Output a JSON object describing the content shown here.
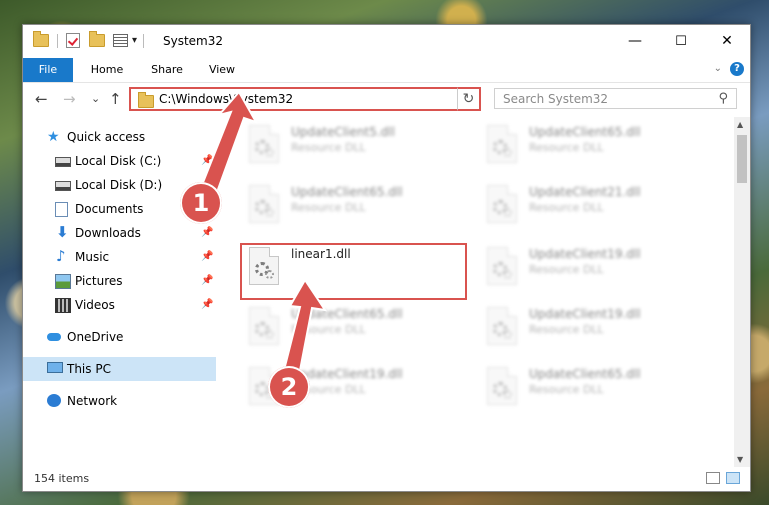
{
  "window": {
    "title": "System32",
    "min_glyph": "—",
    "max_glyph": "☐",
    "close_glyph": "✕"
  },
  "quick_access_toolbar": {
    "customize_glyph": "▾"
  },
  "ribbon": {
    "tabs": [
      "File",
      "Home",
      "Share",
      "View"
    ],
    "help_glyph": "?",
    "expand_glyph": "⌄"
  },
  "nav_buttons": {
    "back_glyph": "←",
    "forward_glyph": "→",
    "recent_glyph": "⌄",
    "up_glyph": "↑"
  },
  "address_bar": {
    "path": "C:\\Windows\\System32",
    "dropdown_glyph": "⌄",
    "refresh_glyph": "↻"
  },
  "search": {
    "placeholder": "Search System32",
    "icon_glyph": "⚲"
  },
  "nav_pane": {
    "items": [
      {
        "label": "Quick access",
        "icon": "star-icon",
        "pinned": false
      },
      {
        "label": "Local Disk (C:)",
        "icon": "drive-icon",
        "pinned": true
      },
      {
        "label": "Local Disk (D:)",
        "icon": "drive-icon",
        "pinned": false
      },
      {
        "label": "Documents",
        "icon": "documents-icon",
        "pinned": true
      },
      {
        "label": "Downloads",
        "icon": "downloads-icon",
        "pinned": true
      },
      {
        "label": "Music",
        "icon": "music-icon",
        "pinned": true
      },
      {
        "label": "Pictures",
        "icon": "pictures-icon",
        "pinned": true
      },
      {
        "label": "Videos",
        "icon": "videos-icon",
        "pinned": true
      },
      {
        "label": "OneDrive",
        "icon": "onedrive-icon",
        "pinned": false
      },
      {
        "label": "This PC",
        "icon": "this-pc-icon",
        "pinned": false,
        "selected": true
      },
      {
        "label": "Network",
        "icon": "network-icon",
        "pinned": false
      }
    ],
    "pin_glyph": "📌"
  },
  "files": [
    {
      "name": "UpdateClient5.dll",
      "type": "Resource DLL",
      "blurred": true
    },
    {
      "name": "UpdateClient65.dll",
      "type": "Resource DLL",
      "blurred": true
    },
    {
      "name": "UpdateClient65.dll",
      "type": "Resource DLL",
      "blurred": true
    },
    {
      "name": "UpdateClient21.dll",
      "type": "Resource DLL",
      "blurred": true
    },
    {
      "name": "linear1.dll",
      "type": "",
      "blurred": false,
      "highlighted": true
    },
    {
      "name": "UpdateClient19.dll",
      "type": "Resource DLL",
      "blurred": true
    },
    {
      "name": "UpdateClient65.dll",
      "type": "Resource DLL",
      "blurred": true
    },
    {
      "name": "UpdateClient19.dll",
      "type": "Resource DLL",
      "blurred": true
    },
    {
      "name": "UpdateClient19.dll",
      "type": "Resource DLL",
      "blurred": true
    },
    {
      "name": "UpdateClient65.dll",
      "type": "Resource DLL",
      "blurred": true
    }
  ],
  "status_bar": {
    "item_count": "154 items"
  },
  "scrollbar": {
    "up_glyph": "▲",
    "down_glyph": "▼"
  },
  "annotations": {
    "step1": "1",
    "step2": "2",
    "color": "#d9534f"
  }
}
